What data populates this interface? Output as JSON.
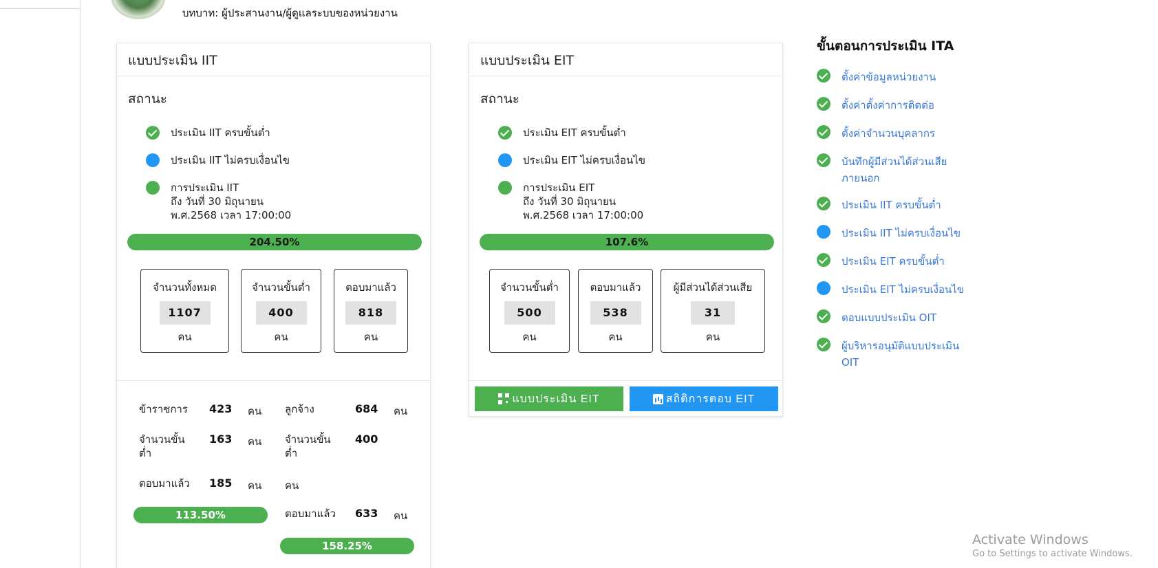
{
  "header": {
    "role": "บทบาท: ผู้ประสานงาน/ผู้ดูแลระบบของหน่วยงาน"
  },
  "iit": {
    "title": "แบบประเมิน IIT",
    "status_title": "สถานะ",
    "status_items": [
      {
        "text": "ประเมิน IIT ครบขั้นต่ำ",
        "icon": "check-circle-icon",
        "color": "#4caf50"
      },
      {
        "text": "ประเมิน IIT ไม่ครบเงื่อนไข",
        "icon": "blue-dot-icon",
        "color": "#2196f3"
      },
      {
        "line1": "การประเมิน IIT",
        "line2": "ถึง วันที่ 30 มิถุนายน",
        "line3": "พ.ศ.2568 เวลา 17:00:00",
        "icon": "green-dot-icon",
        "color": "#4caf50"
      }
    ],
    "progress": {
      "label": "204.50%",
      "value": 204.5
    },
    "boxes": [
      {
        "label": "จำนวนทั้งหมด",
        "value": "1107",
        "unit": "คน"
      },
      {
        "label": "จำนวนขั้นต่ำ",
        "value": "400",
        "unit": "คน"
      },
      {
        "label": "ตอบมาแล้ว",
        "value": "818",
        "unit": "คน"
      }
    ],
    "breakdown": {
      "civil_servant": {
        "label": "ข้าราชการ",
        "count": "423",
        "unit": "คน",
        "min_label_1": "จำนวนขั้น",
        "min_label_2": "ต่ำ",
        "min": "163",
        "min_unit": "คน",
        "answered_label": "ตอบมาแล้ว",
        "answered": "185",
        "answered_unit": "คน",
        "progress": {
          "label": "113.50%",
          "value": 113.5
        }
      },
      "employee": {
        "label": "ลูกจ้าง",
        "count": "684",
        "unit": "คน",
        "min_label_1": "จำนวนขั้น",
        "min_label_2": "ต่ำ",
        "min": "400",
        "min_unit": "คน",
        "answered_label": "ตอบมาแล้ว",
        "answered": "633",
        "answered_unit": "คน",
        "progress": {
          "label": "158.25%",
          "value": 158.25
        }
      }
    }
  },
  "eit": {
    "title": "แบบประเมิน EIT",
    "status_title": "สถานะ",
    "status_items": [
      {
        "text": "ประเมิน EIT ครบขั้นต่ำ",
        "icon": "check-circle-icon",
        "color": "#4caf50"
      },
      {
        "text": "ประเมิน EIT ไม่ครบเงื่อนไข",
        "icon": "blue-dot-icon",
        "color": "#2196f3"
      },
      {
        "line1": "การประเมิน EIT",
        "line2": "ถึง วันที่ 30 มิถุนายน",
        "line3": "พ.ศ.2568 เวลา 17:00:00",
        "icon": "green-dot-icon",
        "color": "#4caf50"
      }
    ],
    "progress": {
      "label": "107.6%",
      "value": 107.6
    },
    "boxes": [
      {
        "label": "จำนวนขั้นต่ำ",
        "value": "500",
        "unit": "คน"
      },
      {
        "label": "ตอบมาแล้ว",
        "value": "538",
        "unit": "คน"
      },
      {
        "label": "ผู้มีส่วนได้ส่วนเสีย",
        "value": "31",
        "unit": "คน"
      }
    ],
    "buttons": {
      "form": {
        "label": "แบบประเมิน EIT",
        "icon": "qr-code-icon",
        "color": "#4caf50"
      },
      "stats": {
        "label": "สถิติการตอบ EIT",
        "icon": "bar-chart-icon",
        "color": "#2196f3"
      }
    }
  },
  "steps": {
    "title": "ขั้นตอนการประเมิน ITA",
    "items": [
      {
        "line1": "ตั้งค่าข้อมูลหน่วยงาน",
        "status": "done"
      },
      {
        "line1": "ตั้งค่าตั้งค่าการติดต่อ",
        "status": "done"
      },
      {
        "line1": "ตั้งค่าจำนวนบุคลากร",
        "status": "done"
      },
      {
        "line1": "บันทึกผู้มีส่วนได้ส่วนเสีย",
        "line2": "ภายนอก",
        "status": "done"
      },
      {
        "line1": "ประเมิน IIT ครบขั้นต่ำ",
        "status": "done"
      },
      {
        "line1": "ประเมิน IIT ไม่ครบเงื่อนไข",
        "status": "pending"
      },
      {
        "line1": "ประเมิน EIT ครบขั้นต่ำ",
        "status": "done"
      },
      {
        "line1": "ประเมิน EIT ไม่ครบเงื่อนไข",
        "status": "pending"
      },
      {
        "line1": "ตอบแบบประเมิน OIT",
        "status": "done"
      },
      {
        "line1": "ผู้บริหารอนุมัติแบบประเมิน",
        "line2": "OIT",
        "status": "done"
      }
    ]
  },
  "watermark": {
    "title": "Activate Windows",
    "subtitle": "Go to Settings to activate Windows."
  },
  "colors": {
    "green": "#4caf50",
    "blue": "#2196f3",
    "link": "#3a78d6"
  }
}
